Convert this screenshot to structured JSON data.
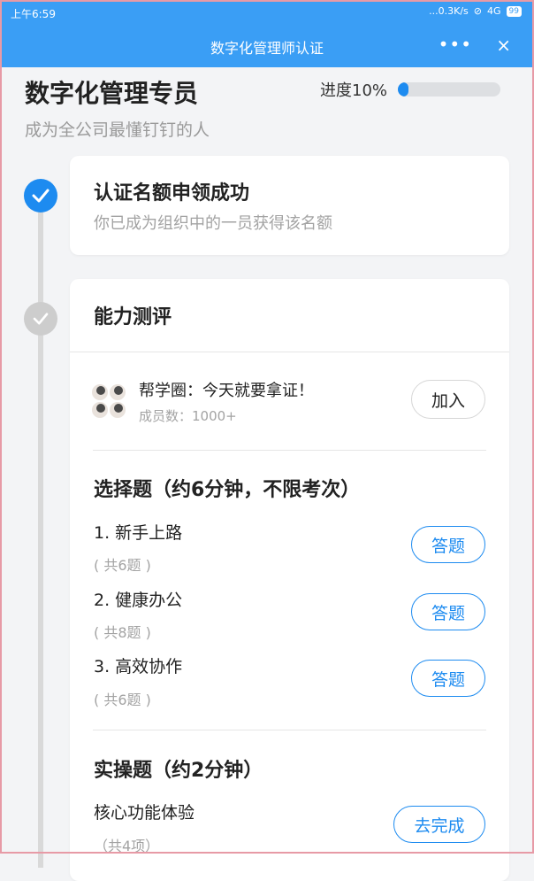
{
  "status": {
    "time": "上午6:59",
    "network": "...0.3K/s",
    "signal": "4G",
    "battery": "99"
  },
  "titlebar": {
    "title": "数字化管理师认证",
    "more": "•••",
    "close": "×"
  },
  "header": {
    "title": "数字化管理专员",
    "subtitle": "成为全公司最懂钉钉的人",
    "progress_label": "进度10%",
    "progress_value": 0.1
  },
  "step1": {
    "title": "认证名额申领成功",
    "desc": "你已成为组织中的一员获得该名额"
  },
  "step2": {
    "title": "能力测评",
    "group": {
      "name": "帮学圈：今天就要拿证！",
      "members": "成员数：1000+",
      "join_label": "加入"
    },
    "choice_section": {
      "title": "选择题（约6分钟，不限考次）",
      "items": [
        {
          "label": "1. 新手上路",
          "count": "( 共6题 )",
          "action": "答题"
        },
        {
          "label": "2. 健康办公",
          "count": "( 共8题 )",
          "action": "答题"
        },
        {
          "label": "3. 高效协作",
          "count": "( 共6题 )",
          "action": "答题"
        }
      ]
    },
    "practice_section": {
      "title": "实操题（约2分钟）",
      "items": [
        {
          "label": "核心功能体验",
          "count": "（共4项）",
          "action": "去完成"
        }
      ]
    }
  },
  "colors": {
    "primary": "#3a9ef5",
    "accent": "#1d8bf0"
  }
}
